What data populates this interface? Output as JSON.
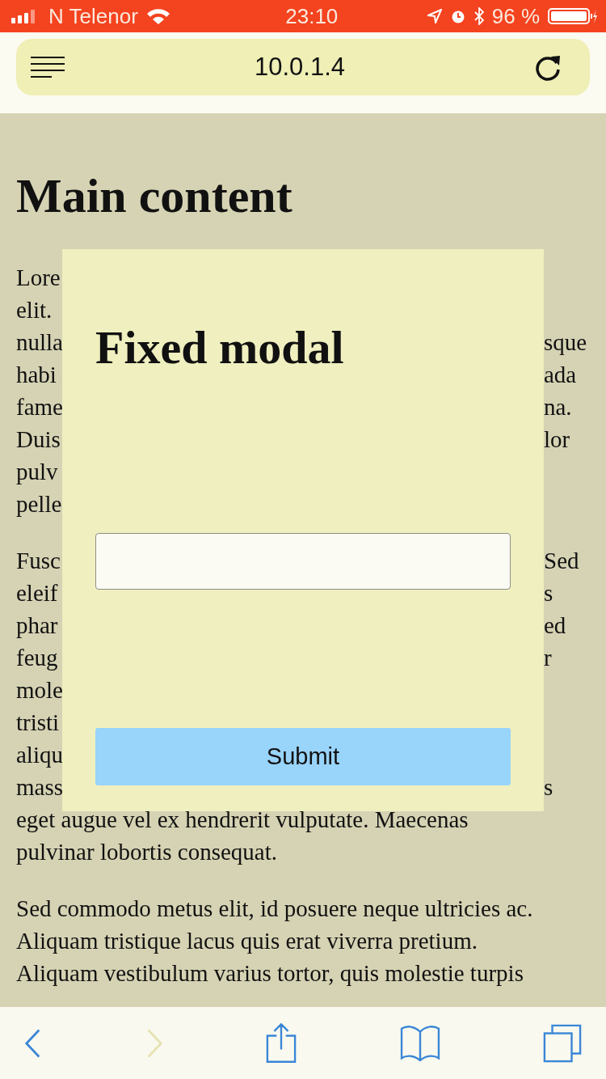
{
  "status_bar": {
    "carrier": "N Telenor",
    "time": "23:10",
    "battery": "96 %"
  },
  "address_bar": {
    "url": "10.0.1.4"
  },
  "page": {
    "heading": "Main content",
    "paragraphs": [
      {
        "lines": [
          {
            "left": "Lore"
          },
          {
            "left": "elit."
          },
          {
            "left": "nulla",
            "right": "sque"
          },
          {
            "left": "habi",
            "right": "ada"
          },
          {
            "left": "fame",
            "right": "na."
          },
          {
            "left": "Duis",
            "right": "lor"
          },
          {
            "left": "pulv"
          },
          {
            "left": "pelle"
          }
        ]
      },
      {
        "lines": [
          {
            "left": "Fusc",
            "right": "Sed"
          },
          {
            "left": "eleif",
            "right": "s"
          },
          {
            "left": "phar",
            "right": "ed"
          },
          {
            "left": "feug",
            "right": "r"
          },
          {
            "left": "mole"
          },
          {
            "left": "tristi"
          },
          {
            "left": "aliqu"
          },
          {
            "left": "mass",
            "right": "s"
          },
          {
            "text": "eget augue vel ex hendrerit vulputate. Maecenas"
          },
          {
            "text": "pulvinar lobortis consequat."
          }
        ]
      },
      {
        "lines": [
          {
            "text": "Sed commodo metus elit, id posuere neque ultricies ac."
          },
          {
            "text": "Aliquam tristique lacus quis erat viverra pretium."
          },
          {
            "text": "Aliquam vestibulum varius tortor, quis molestie turpis"
          }
        ]
      }
    ]
  },
  "modal": {
    "title": "Fixed modal",
    "button": "Submit"
  },
  "toolbar": [
    {
      "kind": "back",
      "disabled": false
    },
    {
      "kind": "forward",
      "disabled": true
    },
    {
      "kind": "share",
      "disabled": false
    },
    {
      "kind": "bookmarks",
      "disabled": false
    },
    {
      "kind": "tabs",
      "disabled": false
    }
  ]
}
